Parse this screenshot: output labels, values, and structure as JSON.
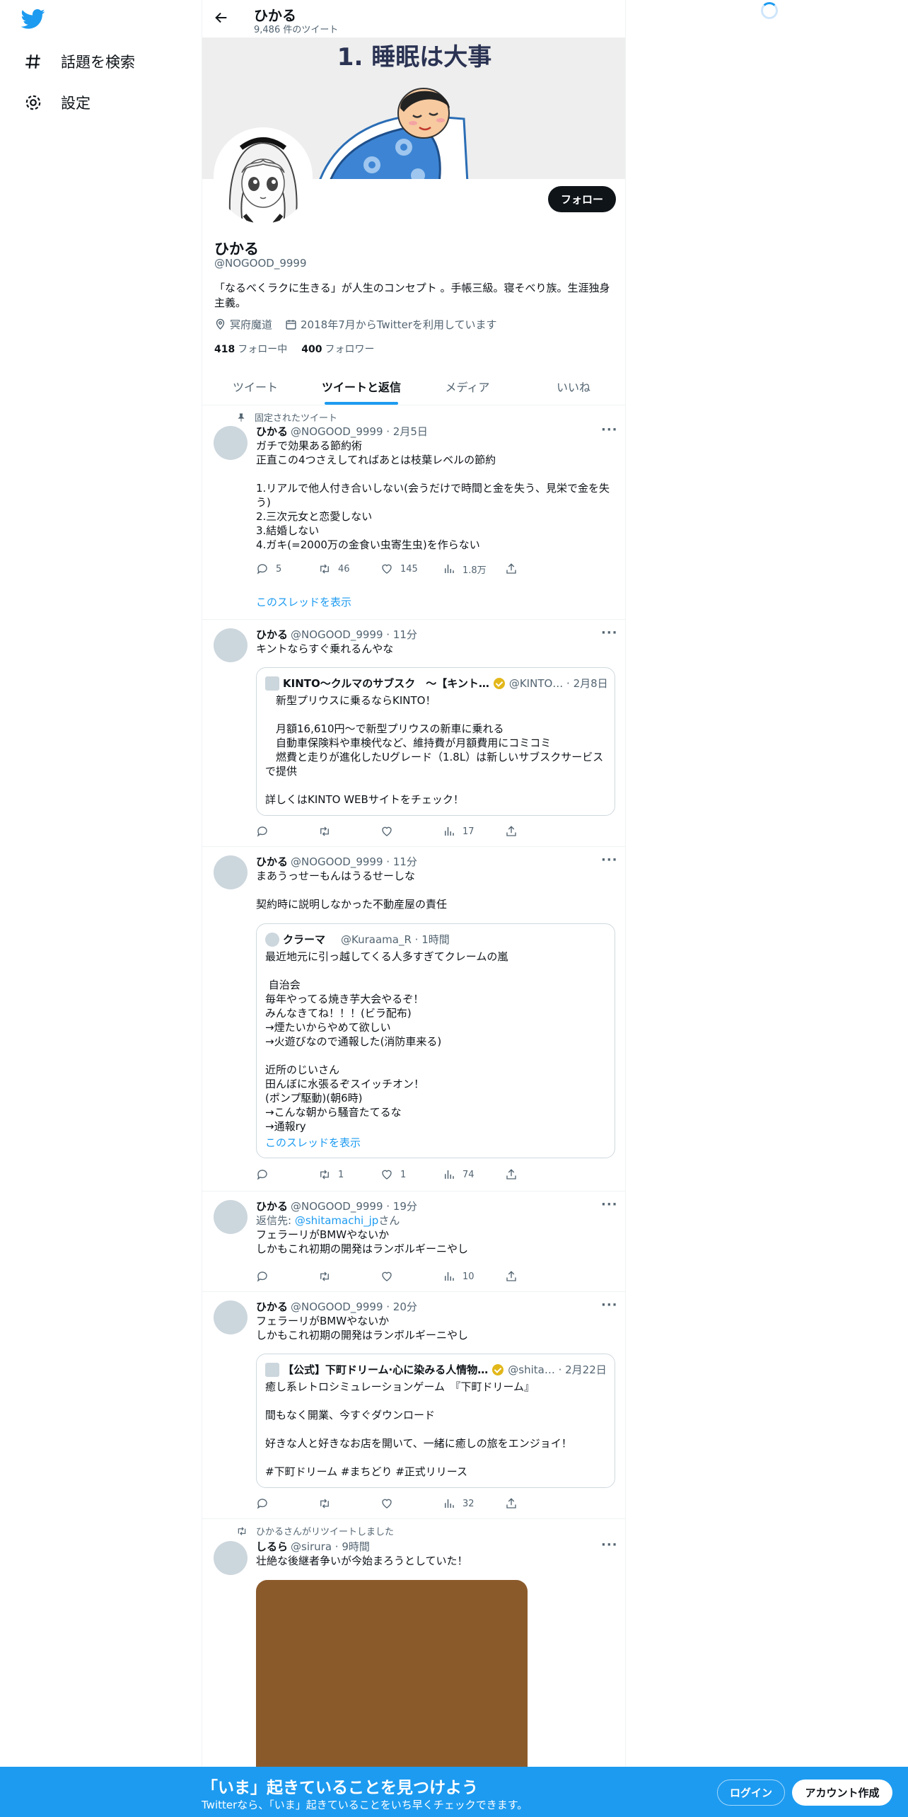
{
  "nav": {
    "explore_label": "話題を検索",
    "settings_label": "設定"
  },
  "profile": {
    "top_name": "ひかる",
    "tweet_count": "9,486 件のツイート",
    "banner_text": "1. 睡眠は大事",
    "name": "ひかる",
    "handle": "@NOGOOD_9999",
    "follow_label": "フォロー",
    "bio": "「なるべくラクに生きる」が人生のコンセプト 。手帳三級。寝そべり族。生涯独身主義。",
    "location": "冥府魔道",
    "joined": "2018年7月からTwitterを利用しています",
    "following_count": "418",
    "following_label": "フォロー中",
    "followers_count": "400",
    "followers_label": "フォロワー"
  },
  "tabs": [
    "ツイート",
    "ツイートと返信",
    "メディア",
    "いいね"
  ],
  "tweets": [
    {
      "pinned_label": "固定されたツイート",
      "name": "ひかる",
      "meta": "@NOGOOD_9999 · 2月5日",
      "text": "ガチで効果ある節約術\n正直この4つさえしてればあとは枝葉レベルの節約\n\n1.リアルで他人付き合いしない(会うだけで時間と金を失う、見栄で金を失う)\n2.三次元女と恋愛しない\n3.結婚しない\n4.ガキ(=2000万の金食い虫寄生虫)を作らない",
      "replies": "5",
      "retweets": "46",
      "likes": "145",
      "views": "1.8万",
      "thread_link": "このスレッドを表示"
    },
    {
      "name": "ひかる",
      "meta": "@NOGOOD_9999 · 11分",
      "text": "キントならすぐ乗れるんやな",
      "quote": {
        "name": "KINTO～クルマのサブスク　～【キント…",
        "meta": "@KINTO… · 2月8日",
        "text": "　新型プリウスに乗るならKINTO！\n\n　月額16,610円〜で新型プリウスの新車に乗れる\n　自動車保険料や車検代など、維持費が月額費用にコミコミ\n　燃費と走りが進化したUグレード（1.8L）は新しいサブスクサービスで提供\n\n詳しくはKINTO WEBサイトをチェック！"
      },
      "replies": "",
      "retweets": "",
      "likes": "",
      "views": "17"
    },
    {
      "name": "ひかる",
      "meta": "@NOGOOD_9999 · 11分",
      "text": "まあうっせーもんはうるせーしな\n\n契約時に説明しなかった不動産屋の責任",
      "quote": {
        "name": "クラーマ",
        "meta": "@Kuraama_R · 1時間",
        "text": "最近地元に引っ越してくる人多すぎてクレームの嵐\n\n 自治会\n毎年やってる焼き芋大会やるぞ！\nみんなきてね！！！(ビラ配布)\n→煙たいからやめて欲しい\n→火遊びなので通報した(消防車来る)\n\n近所のじいさん\n田んぼに水張るぞスイッチオン！\n(ポンプ駆動)(朝6時)\n→こんな朝から騒音たてるな\n→通報ry",
        "link": "このスレッドを表示"
      },
      "replies": "",
      "retweets": "1",
      "likes": "1",
      "views": "74"
    },
    {
      "name": "ひかる",
      "meta": "@NOGOOD_9999 · 19分",
      "reply_prefix": "返信先: ",
      "reply_to": "@shitamachi_jp",
      "reply_suffix": "さん",
      "text": "フェラーリがBMWやないか\nしかもこれ初期の開発はランボルギーニやし",
      "replies": "",
      "retweets": "",
      "likes": "",
      "views": "10"
    },
    {
      "name": "ひかる",
      "meta": "@NOGOOD_9999 · 20分",
      "text": "フェラーリがBMWやないか\nしかもこれ初期の開発はランボルギーニやし",
      "quote": {
        "name": "【公式】下町ドリーム·心に染みる人情物…",
        "meta": "@shita… · 2月22日",
        "text": "癒し系レトロシミュレーションゲーム　『下町ドリーム』\n\n間もなく開業、今すぐダウンロード\n\n好きな人と好きなお店を開いて、一緒に癒しの旅をエンジョイ！\n\n#下町ドリーム #まちどり #正式リリース"
      },
      "replies": "",
      "retweets": "",
      "likes": "",
      "views": "32"
    },
    {
      "retweeted_label": "ひかるさんがリツイートしました",
      "name": "しるら",
      "meta": "@sirura · 9時間",
      "text": "壮絶な後継者争いが今始まろうとしていた！",
      "media_color": "#8b5a2b"
    }
  ],
  "bottom": {
    "title": "「いま」起きていることを見つけよう",
    "subtitle": "Twitterなら、「いま」起きていることをいち早くチェックできます。",
    "login_label": "ログイン",
    "signup_label": "アカウント作成"
  },
  "colors": {
    "accent": "#1d9bf0",
    "text": "#0f1419",
    "muted": "#536471",
    "verified_badge": "#e2b719"
  }
}
